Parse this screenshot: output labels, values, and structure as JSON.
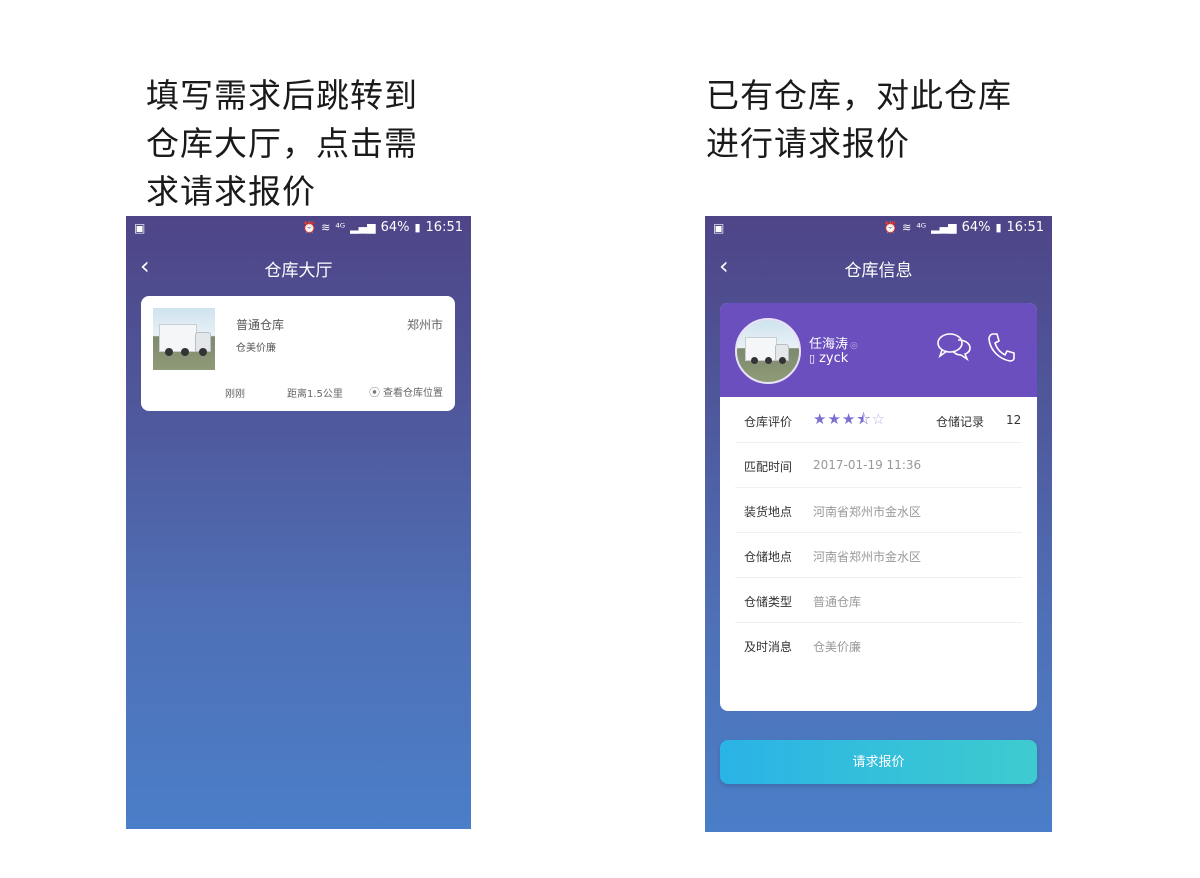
{
  "captions": {
    "left": "填写需求后跳转到\n仓库大厅，点击需\n求请求报价",
    "right": "已有仓库，对此仓库\n进行请求报价"
  },
  "status_bar": {
    "signal_text": "⁴ᴳ",
    "battery": "64%",
    "time": "16:51"
  },
  "hall_screen": {
    "title": "仓库大厅",
    "warehouse_card": {
      "type": "普通仓库",
      "city": "郑州市",
      "slogan": "仓美价廉",
      "posted": "刚刚",
      "distance": "距离1.5公里",
      "location_link": "查看仓库位置"
    }
  },
  "info_screen": {
    "title": "仓库信息",
    "owner": {
      "name": "任海涛",
      "company": "zyck"
    },
    "rating": {
      "label": "仓库评价",
      "stars": 3.5,
      "max_stars": 5,
      "record_label": "仓储记录",
      "record_count": "12"
    },
    "rows": [
      {
        "label": "匹配时间",
        "value": "2017-01-19 11:36"
      },
      {
        "label": "装货地点",
        "value": "河南省郑州市金水区"
      },
      {
        "label": "仓储地点",
        "value": "河南省郑州市金水区"
      },
      {
        "label": "仓储类型",
        "value": "普通仓库"
      },
      {
        "label": "及时消息",
        "value": "仓美价廉"
      }
    ],
    "request_button": "请求报价"
  },
  "colors": {
    "header_purple": "#6b4fbf",
    "star": "#7b6fd2",
    "button_gradient_start": "#2ab3e6",
    "button_gradient_end": "#3ecbcf"
  },
  "icons": [
    "alarm-icon",
    "wifi-icon",
    "signal-icon",
    "battery-icon",
    "back-icon",
    "location-pin-icon",
    "chat-icon",
    "phone-call-icon",
    "verified-icon",
    "mobile-icon",
    "star-icon"
  ]
}
